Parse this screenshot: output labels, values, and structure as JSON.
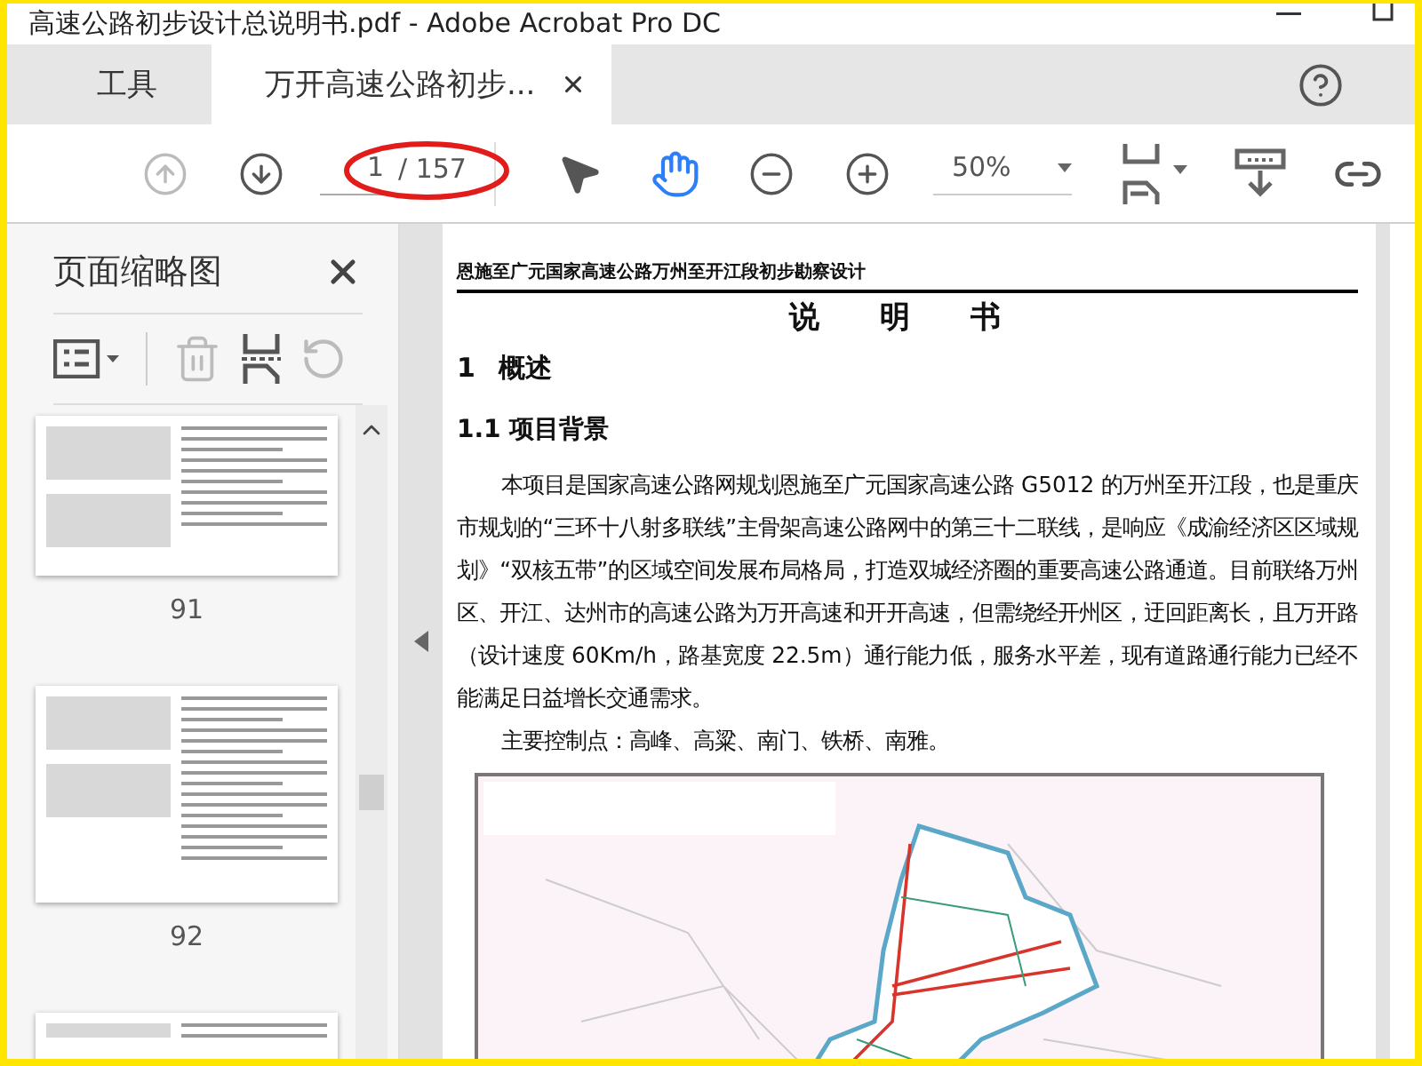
{
  "window": {
    "title": "高速公路初步设计总说明书.pdf - Adobe Acrobat Pro DC"
  },
  "tabs": [
    {
      "label": "工具",
      "selected": false,
      "closable": false
    },
    {
      "label": "万开高速公路初步...",
      "selected": true,
      "closable": true
    }
  ],
  "toolbar": {
    "prev_disabled": true,
    "page_value": "1",
    "page_total": "/ 157",
    "zoom": "50%",
    "tools": [
      {
        "kind": "select",
        "selected": false
      },
      {
        "kind": "hand",
        "selected": true
      }
    ]
  },
  "sidebar": {
    "title": "页面缩略图",
    "trash_disabled": true,
    "thumbnails": [
      {
        "kind": "full",
        "label": "91",
        "selected": false
      },
      {
        "kind": "full",
        "label": "92",
        "selected": false
      },
      {
        "kind": "partial",
        "selected": false
      }
    ]
  },
  "page": {
    "running_header": "恩施至广元国家高速公路万州至开江段初步勘察设计",
    "title": "说 明 书",
    "blocks": [
      {
        "kind": "h1",
        "text": "1 概述"
      },
      {
        "kind": "h2",
        "text": "1.1 项目背景"
      },
      {
        "kind": "p",
        "text": "本项目是国家高速公路网规划恩施至广元国家高速公路 G5012 的万州至开江段，也是重庆市规划的“三环十八射多联线”主骨架高速公路网中的第三十二联线，是响应《成渝经济区区域规划》“双核五带”的区域空间发展布局格局，打造双城经济圈的重要高速公路通道。目前联络万州区、开江、达州市的高速公路为万开高速和开开高速，但需绕经开州区，迂回距离长，且万开路（设计速度 60Km/h，路基宽度 22.5m）通行能力低，服务水平差，现有道路通行能力已经不能满足日益增长交通需求。"
      },
      {
        "kind": "p",
        "text": "主要控制点：高峰、高粱、南门、铁桥、南雅。"
      },
      {
        "kind": "figure"
      }
    ]
  }
}
